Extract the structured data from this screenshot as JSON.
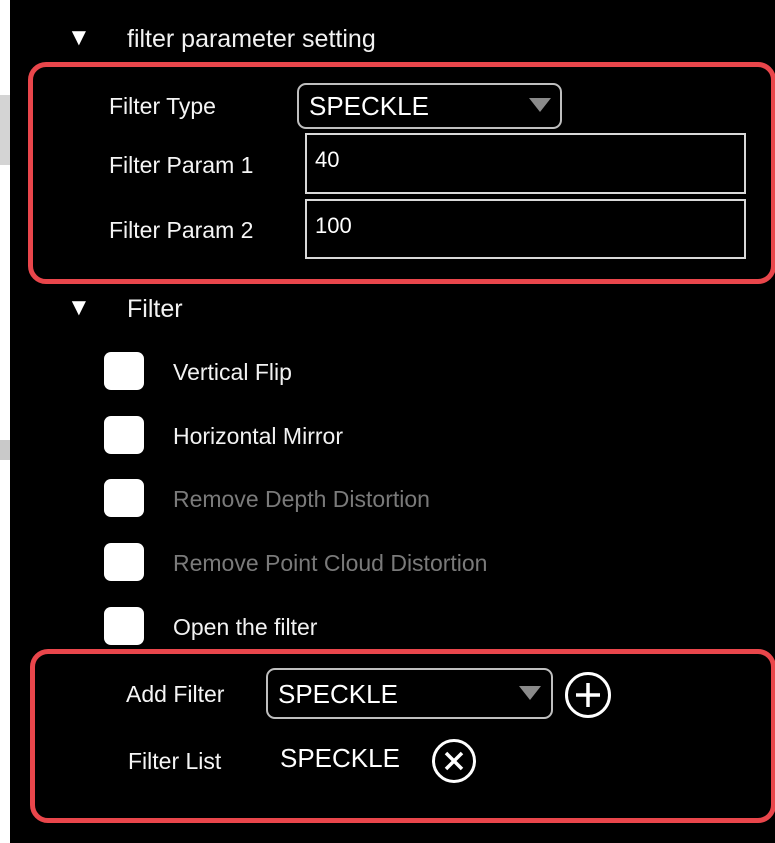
{
  "params_section": {
    "title": "filter parameter setting",
    "filter_type_label": "Filter Type",
    "filter_type_value": "SPECKLE",
    "param1_label": "Filter Param 1",
    "param1_value": "40",
    "param2_label": "Filter Param 2",
    "param2_value": "100"
  },
  "filter_section": {
    "title": "Filter",
    "checkboxes": [
      {
        "label": "Vertical Flip",
        "checked": false,
        "enabled": true
      },
      {
        "label": "Horizontal Mirror",
        "checked": false,
        "enabled": true
      },
      {
        "label": "Remove Depth Distortion",
        "checked": false,
        "enabled": false
      },
      {
        "label": "Remove Point Cloud Distortion",
        "checked": false,
        "enabled": false
      },
      {
        "label": "Open the filter",
        "checked": false,
        "enabled": true
      }
    ],
    "add_filter_label": "Add Filter",
    "add_filter_value": "SPECKLE",
    "filter_list_label": "Filter List",
    "filter_list_items": [
      "SPECKLE"
    ]
  },
  "colors": {
    "highlight": "#e9464b",
    "background": "#000000",
    "disabled_text": "#7a7a7a"
  },
  "icons": {
    "section_toggle": "triangle-down-icon",
    "dropdown": "dropdown-arrow-icon",
    "add": "plus-circle-icon",
    "remove": "x-circle-icon"
  }
}
